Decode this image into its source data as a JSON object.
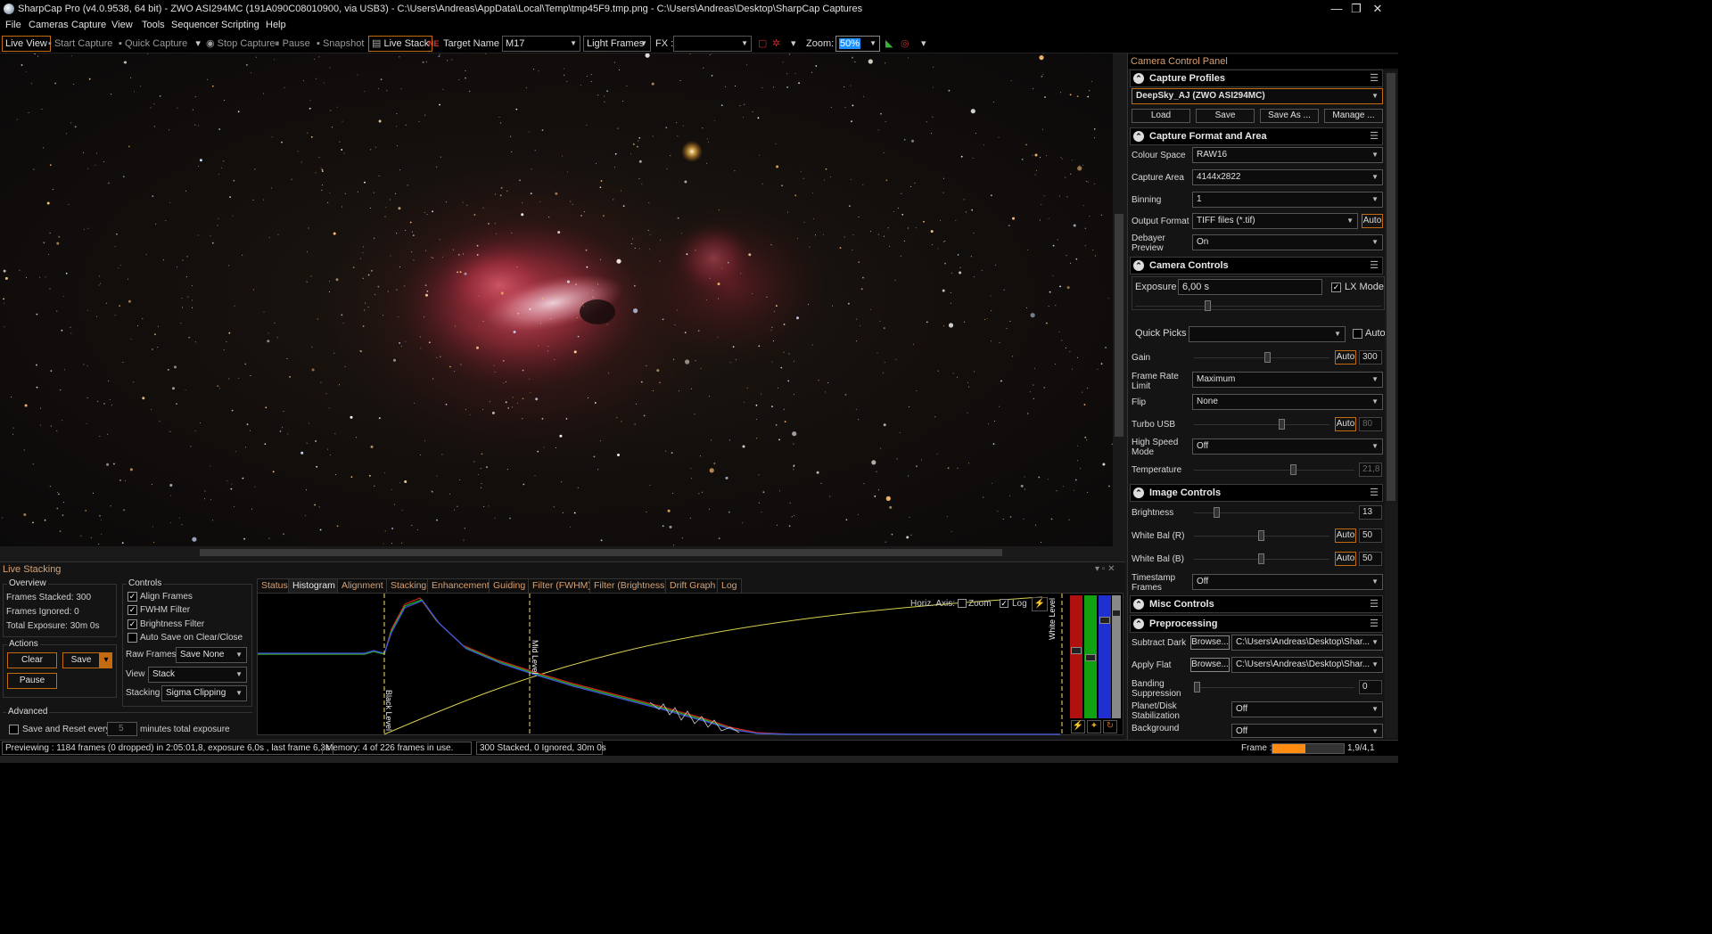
{
  "window": {
    "title": "SharpCap Pro (v4.0.9538, 64 bit) - ZWO ASI294MC (191A090C08010900, via USB3) - C:\\Users\\Andreas\\AppData\\Local\\Temp\\tmp45F9.tmp.png - C:\\Users\\Andreas\\Desktop\\SharpCap Captures",
    "minimize": "—",
    "maximize": "❐",
    "close": "✕"
  },
  "menu": [
    "File",
    "Cameras",
    "Capture",
    "View",
    "Tools",
    "Sequencer",
    "Scripting",
    "Help"
  ],
  "toolbar": {
    "live_view": "Live View",
    "start_capture": "Start Capture",
    "quick_capture": "Quick Capture",
    "stop_capture": "Stop Capture",
    "pause": "Pause",
    "snapshot": "Snapshot",
    "live_stack": "Live Stack",
    "target_name_label": "Target Name :",
    "target_name": "M17",
    "frame_type": "Light Frames",
    "fx_label": "FX :",
    "fx_value": "",
    "zoom_label": "Zoom:",
    "zoom_value": "50%"
  },
  "camera_panel": {
    "title": "Camera Control Panel",
    "capture_profiles": {
      "header": "Capture Profiles",
      "profile": "DeepSky_AJ (ZWO ASI294MC)",
      "load": "Load",
      "save": "Save",
      "save_as": "Save As ...",
      "manage": "Manage ..."
    },
    "capture_format": {
      "header": "Capture Format and Area",
      "colour_space_label": "Colour Space",
      "colour_space": "RAW16",
      "capture_area_label": "Capture Area",
      "capture_area": "4144x2822",
      "binning_label": "Binning",
      "binning": "1",
      "output_format_label": "Output Format",
      "output_format": "TIFF files (*.tif)",
      "auto": "Auto",
      "debayer_label": "Debayer Preview",
      "debayer": "On"
    },
    "camera_controls": {
      "header": "Camera Controls",
      "exposure_label": "Exposure",
      "exposure": "6,00 s",
      "lx_mode": "LX Mode",
      "quick_picks_label": "Quick Picks",
      "quick_picks": "",
      "auto": "Auto",
      "gain_label": "Gain",
      "gain": "300",
      "gain_level": 0.55,
      "frame_rate_label": "Frame Rate Limit",
      "frame_rate": "Maximum",
      "flip_label": "Flip",
      "flip": "None",
      "turbo_label": "Turbo USB",
      "turbo": "80",
      "turbo_level": 0.66,
      "high_speed_label": "High Speed Mode",
      "high_speed": "Off",
      "temperature_label": "Temperature",
      "temperature": "21,8",
      "temperature_level": 0.63
    },
    "image_controls": {
      "header": "Image Controls",
      "brightness_label": "Brightness",
      "brightness": "13",
      "brightness_level": 0.13,
      "wb_r_label": "White Bal (R)",
      "wb_r": "50",
      "wb_r_level": 0.5,
      "wb_b_label": "White Bal (B)",
      "wb_b": "50",
      "wb_b_level": 0.5,
      "auto": "Auto",
      "timestamp_label": "Timestamp Frames",
      "timestamp": "Off"
    },
    "misc_controls": {
      "header": "Misc Controls"
    },
    "preprocessing": {
      "header": "Preprocessing",
      "subtract_dark_label": "Subtract Dark",
      "browse": "Browse...",
      "dark_path": "C:\\Users\\Andreas\\Desktop\\Shar...",
      "apply_flat_label": "Apply Flat",
      "flat_path": "C:\\Users\\Andreas\\Desktop\\Shar...",
      "banding_label": "Banding Suppression",
      "banding": "0",
      "planet_label": "Planet/Disk Stabilization",
      "planet": "Off",
      "background_label": "Background Subtraction",
      "background": "Off"
    }
  },
  "live_stacking": {
    "title": "Live Stacking",
    "overview": {
      "title": "Overview",
      "frames_stacked": "Frames Stacked: 300",
      "frames_ignored": "Frames Ignored: 0",
      "total_exposure": "Total Exposure:  30m 0s"
    },
    "actions": {
      "title": "Actions",
      "clear": "Clear",
      "save": "Save",
      "pause": "Pause"
    },
    "advanced": {
      "title": "Advanced",
      "save_reset": "Save and Reset every",
      "minutes": "5",
      "minutes_label": "minutes total exposure"
    },
    "controls": {
      "title": "Controls",
      "align_frames": "Align Frames",
      "fwhm_filter": "FWHM Filter",
      "brightness_filter": "Brightness Filter",
      "auto_save": "Auto Save on Clear/Close",
      "raw_frames_label": "Raw Frames",
      "raw_frames": "Save None",
      "view_label": "View",
      "view": "Stack",
      "stacking_label": "Stacking",
      "stacking": "Sigma Clipping"
    },
    "tabs": [
      "Status",
      "Histogram",
      "Alignment",
      "Stacking",
      "Enhancement",
      "Guiding",
      "Filter (FWHM)",
      "Filter (Brightness)",
      "Drift Graph",
      "Log"
    ],
    "active_tab": 1,
    "histogram": {
      "horiz_axis": "Horiz. Axis:",
      "zoom": "Zoom",
      "log": "Log",
      "black_level": "Black Level",
      "mid_level": "Mid Level",
      "white_level": "White Level"
    }
  },
  "status": {
    "previewing": "Previewing : 1184 frames (0 dropped) in 2:05:01,8, exposure 6,0s , last frame 6,3s",
    "memory": "Memory: 4 of 226 frames in use.",
    "stacked": "300 Stacked, 0 Ignored, 30m 0s",
    "frame_label": "Frame :",
    "frame_value": "1,9/4,1",
    "frame_progress": 0.46
  },
  "colors": {
    "accent": "#c46a10",
    "zoom_highlight": "#1e90ff",
    "nebula": "#c0405a"
  }
}
